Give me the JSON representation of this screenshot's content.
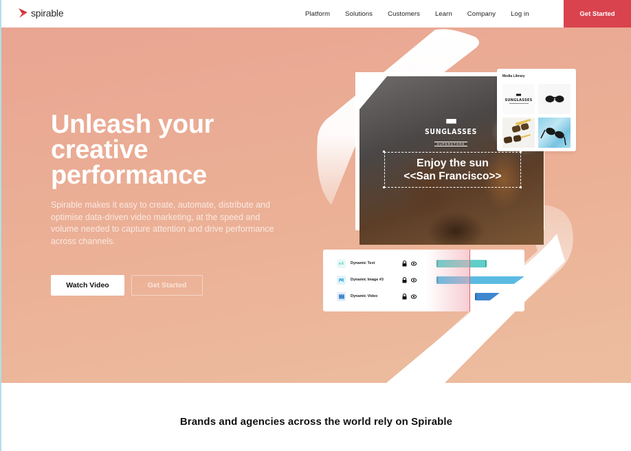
{
  "nav": {
    "logo_text": "spirable",
    "links": [
      "Platform",
      "Solutions",
      "Customers",
      "Learn",
      "Company",
      "Log in"
    ],
    "cta_label": "Get Started"
  },
  "hero": {
    "title": "Unleash your creative performance",
    "description": "Spirable makes it easy to create, automate, distribute and optimise data-driven video marketing, at the speed and volume needed to capture attention and drive performance across channels.",
    "watch_video_label": "Watch Video",
    "get_started_label": "Get Started"
  },
  "preview": {
    "brand_name": "SUNGLASSES",
    "brand_sub": "SUPERSTORE",
    "headline_line1": "Enjoy the sun",
    "headline_line2": "<<San Francisco>>"
  },
  "media_library": {
    "title": "Media Library",
    "thumb1_name": "SUNGLASSES"
  },
  "timeline": {
    "layers": [
      {
        "label": "Dynamic Text",
        "icon": "text-size-icon",
        "color": "#5fcfc8",
        "icon_bg": "#e8f8f7",
        "start": 0.0,
        "end": 0.6
      },
      {
        "label": "Dynamic Image #3",
        "icon": "image-icon",
        "color": "#5bbbe3",
        "icon_bg": "#e3f2fa",
        "start": 0.0,
        "end": 1.0
      },
      {
        "label": "Dynamic Video",
        "icon": "video-icon",
        "color": "#3f86cf",
        "icon_bg": "#e4edf8",
        "start": 0.46,
        "end": 0.75
      }
    ]
  },
  "brands": {
    "title": "Brands and agencies across the world rely on Spirable"
  },
  "colors": {
    "accent": "#d9434d",
    "hero_bg": "#eaab94"
  }
}
